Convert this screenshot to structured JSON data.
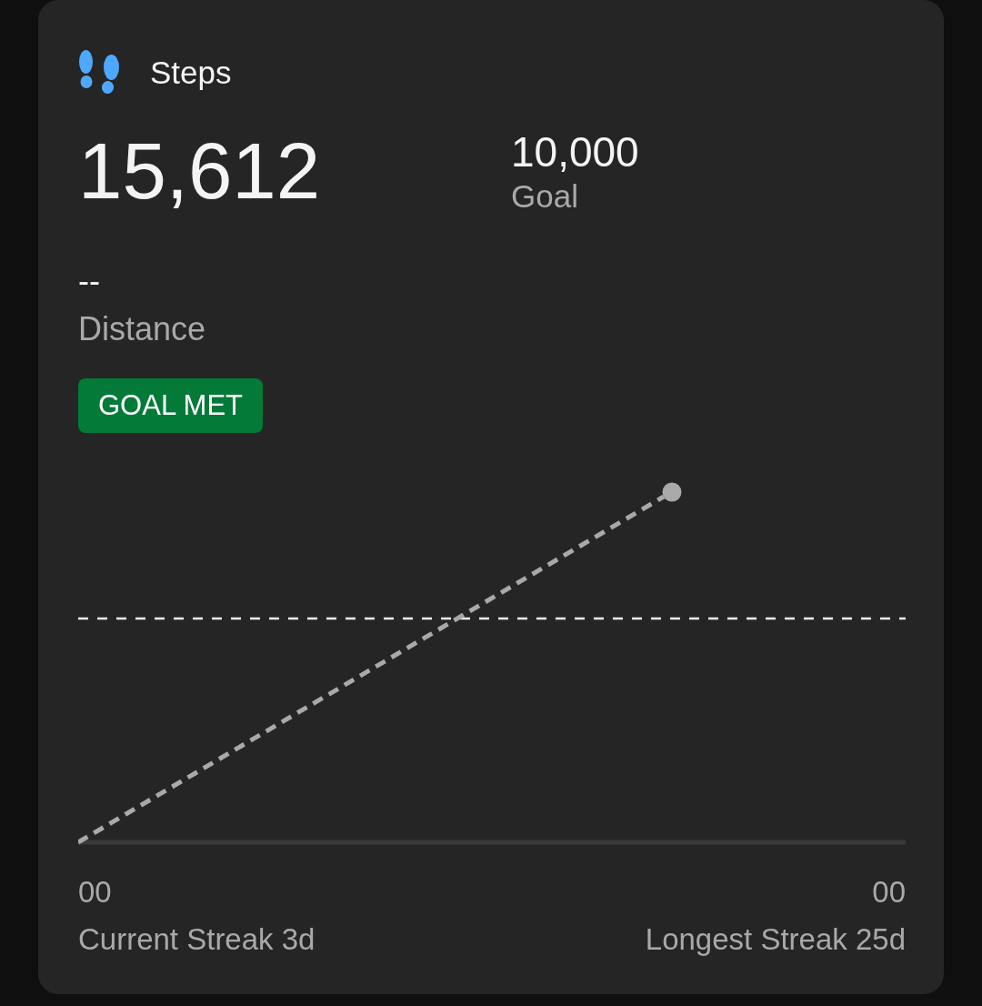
{
  "card": {
    "title": "Steps",
    "value": "15,612",
    "goal": {
      "value": "10,000",
      "label": "Goal"
    },
    "distance": {
      "value": "--",
      "label": "Distance"
    },
    "badge": "GOAL MET",
    "chart": {
      "axis_labels": [
        "00",
        "00"
      ]
    },
    "streaks": [
      "Current Streak 3d",
      "Longest Streak 25d"
    ]
  }
}
